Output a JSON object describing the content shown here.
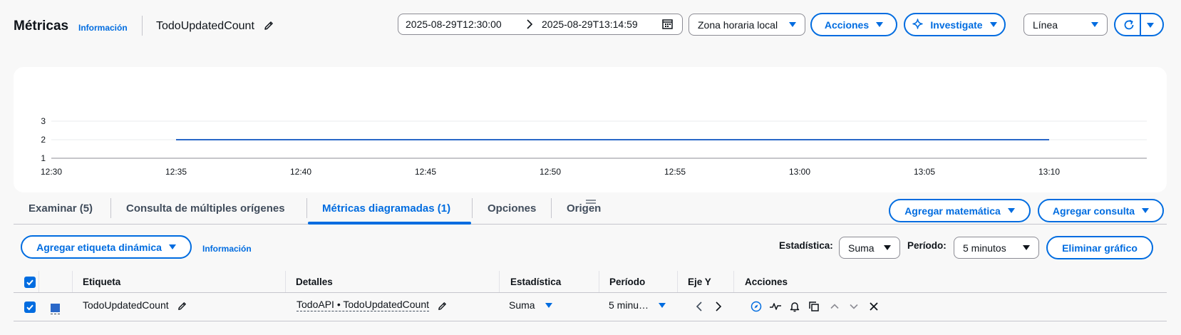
{
  "header": {
    "title": "Métricas",
    "info_link": "Información",
    "metric_name": "TodoUpdatedCount"
  },
  "time_range": {
    "start": "2025-08-29T12:30:00",
    "end": "2025-08-29T13:14:59"
  },
  "toolbar": {
    "timezone": "Zona horaria local",
    "actions": "Acciones",
    "investigate": "Investigate",
    "chart_type": "Línea"
  },
  "chart_data": {
    "type": "line",
    "x": [
      "12:30",
      "12:35",
      "12:40",
      "12:45",
      "12:50",
      "12:55",
      "13:00",
      "13:05",
      "13:10"
    ],
    "y_ticks": [
      "3",
      "2",
      "1"
    ],
    "ylim": [
      1,
      3
    ],
    "series": [
      {
        "values": [
          null,
          2,
          2,
          2,
          2,
          2,
          2,
          2,
          2
        ],
        "color": "#2a68c8"
      }
    ],
    "grid": true
  },
  "tabs": [
    {
      "label": "Examinar (5)"
    },
    {
      "label": "Consulta de múltiples orígenes"
    },
    {
      "label": "Métricas diagramadas (1)"
    },
    {
      "label": "Opciones"
    },
    {
      "label": "Origen"
    }
  ],
  "right_actions": {
    "add_math": "Agregar matemática",
    "add_query": "Agregar consulta"
  },
  "options_bar": {
    "add_label": "Agregar etiqueta dinámica",
    "info_link": "Información",
    "statistic_label": "Estadística:",
    "statistic_value": "Suma",
    "period_label": "Período:",
    "period_value": "5 minutos",
    "delete_chart": "Eliminar gráfico"
  },
  "table": {
    "headers": {
      "label": "Etiqueta",
      "details": "Detalles",
      "statistic": "Estadística",
      "period": "Período",
      "y_axis": "Eje Y",
      "actions": "Acciones"
    },
    "rows": [
      {
        "label": "TodoUpdatedCount",
        "details": "TodoAPI • TodoUpdatedCount",
        "statistic": "Suma",
        "period": "5 minu…",
        "color": "#2a68c8"
      }
    ]
  }
}
